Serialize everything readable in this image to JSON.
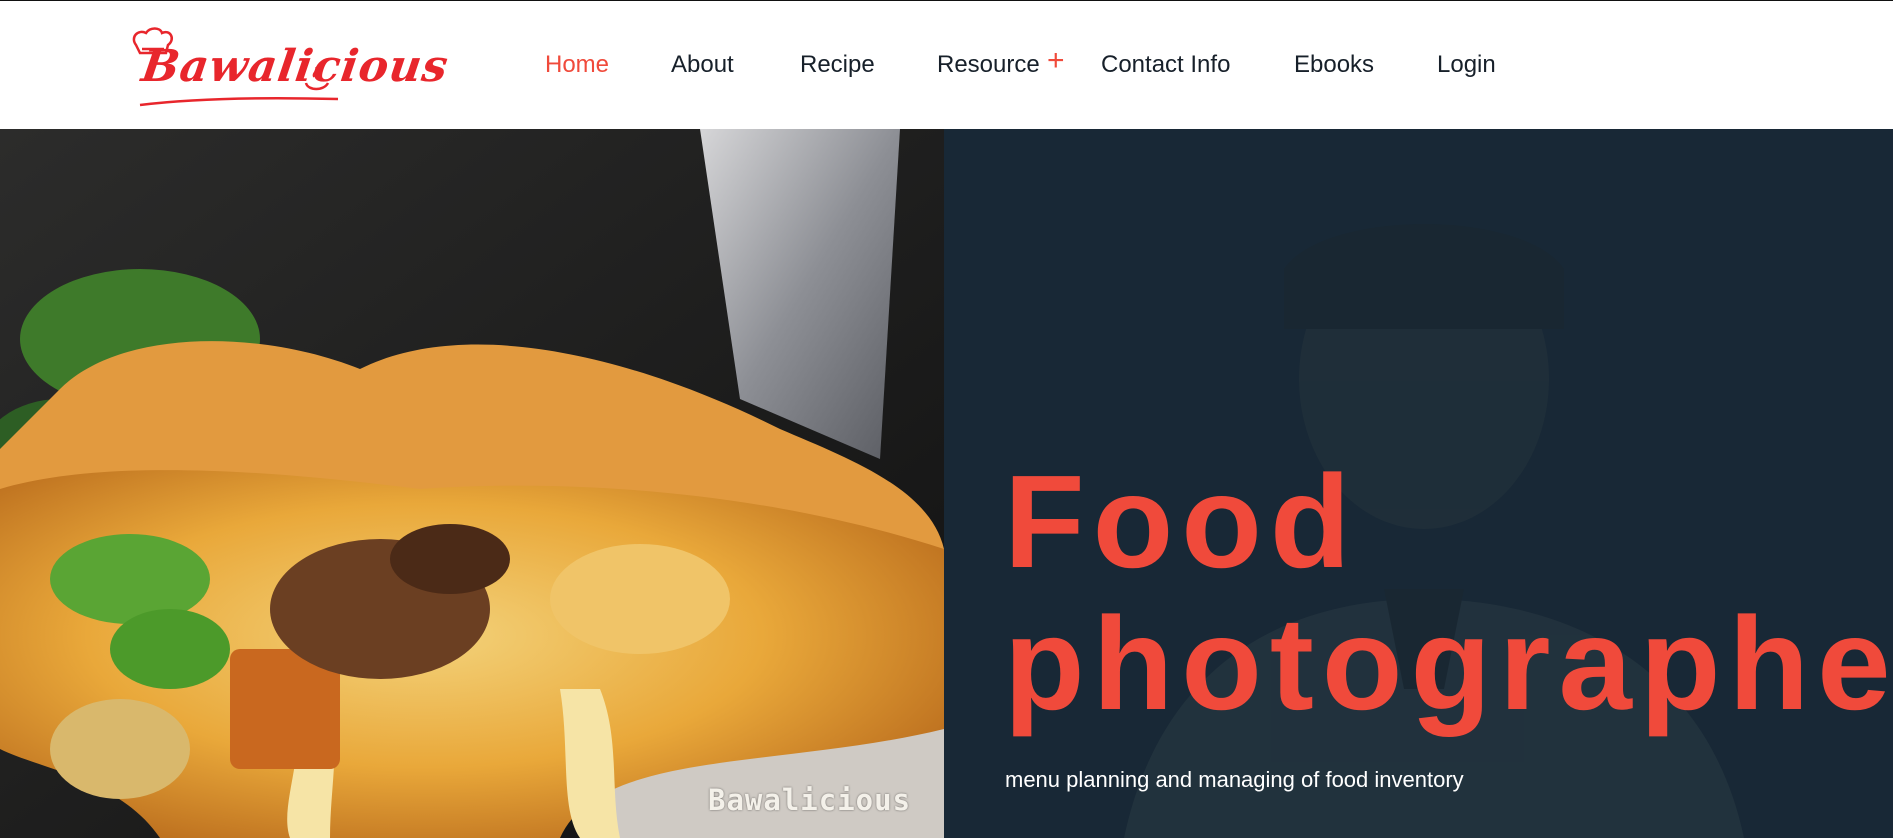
{
  "brand": {
    "logo_text": "Bawalicious",
    "logo_icon": "chef-hat-icon",
    "accent_color": "#f04a3b",
    "logo_color": "#e8262c"
  },
  "nav": {
    "items": [
      {
        "label": "Home",
        "active": true
      },
      {
        "label": "About",
        "active": false
      },
      {
        "label": "Recipe",
        "active": false
      },
      {
        "label": "Resource",
        "active": false
      },
      {
        "label": "Contact Info",
        "active": false
      },
      {
        "label": "Ebooks",
        "active": false
      },
      {
        "label": "Login",
        "active": false
      }
    ],
    "resource_expand_icon": "plus-icon"
  },
  "hero": {
    "left_image": "pizza-slice-cheese-pull-photo",
    "watermark": "Bawalicious",
    "title_line1": "Food",
    "title_line2": "photographer",
    "subtitle": "menu planning and managing of food inventory",
    "right_background_image": "chef-portrait-photo",
    "right_background_color": "#182836"
  }
}
